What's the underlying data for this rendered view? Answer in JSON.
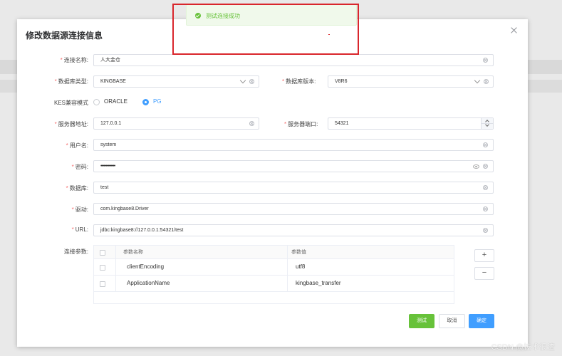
{
  "dialog": {
    "title": "修改数据源连接信息"
  },
  "form": {
    "name": {
      "label": "连接名称:",
      "value": "人大金仓"
    },
    "db_type": {
      "label": "数据库类型:",
      "value": "KINGBASE"
    },
    "db_version": {
      "label": "数据库版本:",
      "value": "V8R6"
    },
    "compat_mode": {
      "label": "KES兼容模式",
      "options": [
        "ORACLE",
        "PG"
      ],
      "selected": "PG"
    },
    "host": {
      "label": "服务器地址:",
      "value": "127.0.0.1"
    },
    "port": {
      "label": "服务器端口:",
      "value": "54321"
    },
    "username": {
      "label": "用户名:",
      "value": "system"
    },
    "password": {
      "label": "密码:",
      "value": "••••••••••••••"
    },
    "database": {
      "label": "数据库:",
      "value": "test"
    },
    "driver": {
      "label": "驱动:",
      "value": "com.kingbase8.Driver"
    },
    "url": {
      "label": "URL:",
      "value": "jdbc:kingbase8://127.0.0.1:54321/test"
    },
    "params": {
      "label": "连接参数:",
      "columns": [
        "参数名称",
        "参数值"
      ],
      "rows": [
        {
          "name": "clientEncoding",
          "value": "utf8"
        },
        {
          "name": "ApplicationName",
          "value": "kingbase_transfer"
        }
      ],
      "add_label": "+",
      "remove_label": "−"
    }
  },
  "buttons": {
    "test": "测试",
    "cancel": "取消",
    "confirm": "确定"
  },
  "toast": {
    "message": "测试连接成功",
    "type": "success"
  },
  "watermark": "CSDN @技术很渣",
  "colors": {
    "primary": "#409eff",
    "success": "#67c23a",
    "required": "#f56c6c",
    "highlight": "#d9262c"
  }
}
